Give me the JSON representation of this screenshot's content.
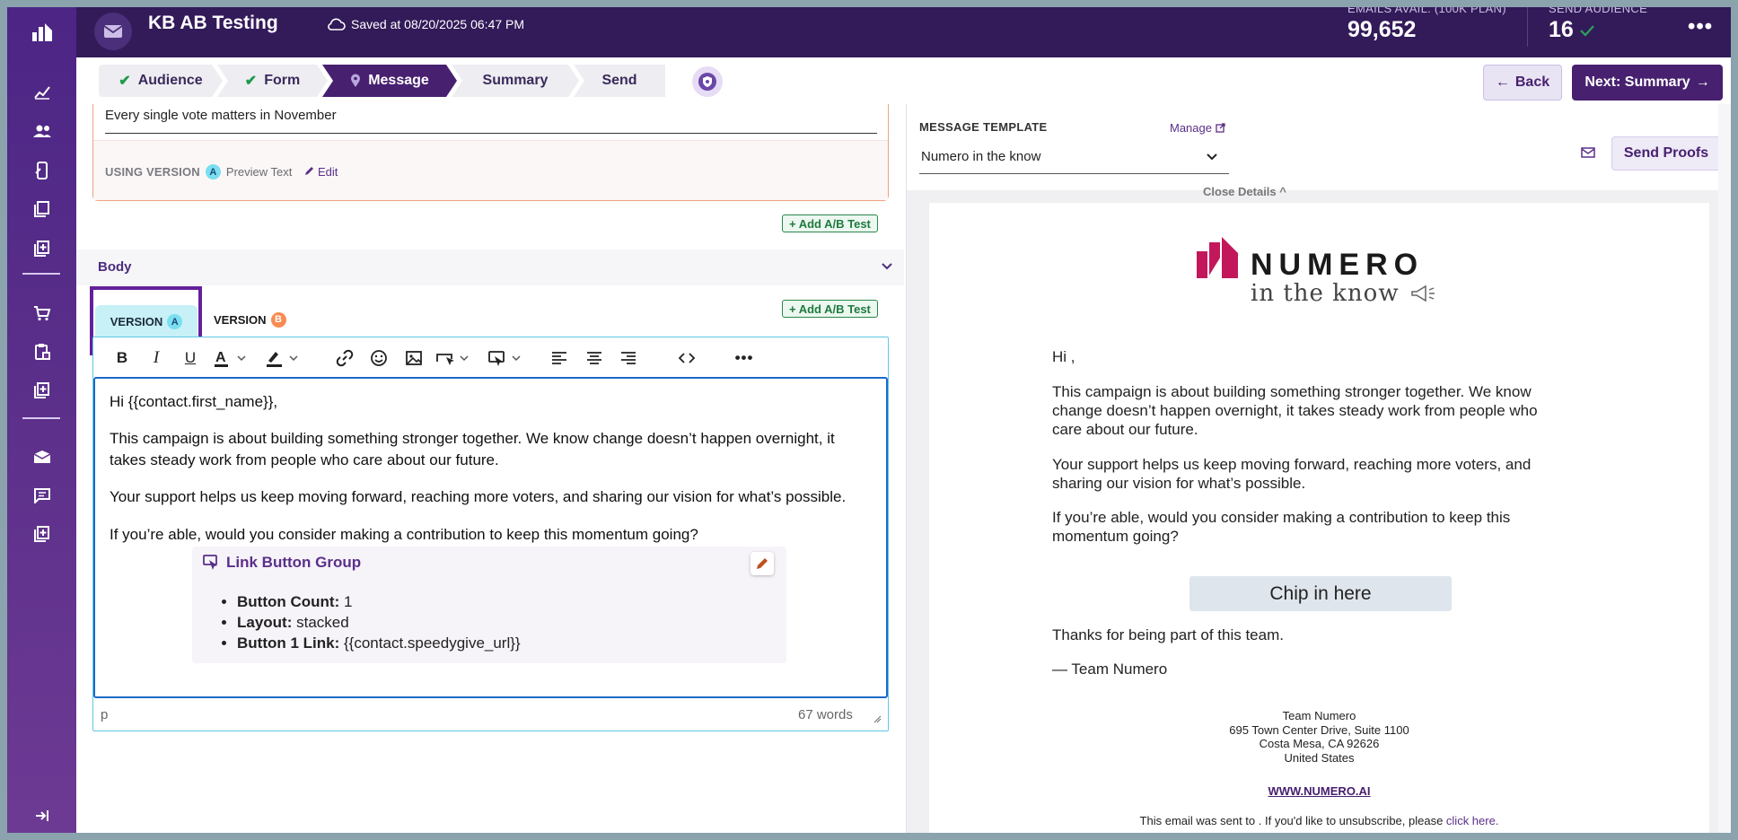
{
  "header": {
    "title": "KB AB Testing",
    "saved_text": "Saved at 08/20/2025 06:47 PM",
    "emails_label": "EMAILS AVAIL. (100K PLAN)",
    "emails_value": "99,652",
    "audience_label": "SEND AUDIENCE",
    "audience_value": "16"
  },
  "steps": [
    {
      "label": "Audience",
      "state": "done"
    },
    {
      "label": "Form",
      "state": "done"
    },
    {
      "label": "Message",
      "state": "active"
    },
    {
      "label": "Summary",
      "state": "todo"
    },
    {
      "label": "Send",
      "state": "todo"
    }
  ],
  "nav": {
    "back_label": "Back",
    "next_label": "Next: Summary"
  },
  "subject": {
    "preview_text": "Every single vote matters in November",
    "using_version_label": "USING VERSION",
    "version": "A",
    "field_name": "Preview Text",
    "edit_label": "Edit"
  },
  "add_ab_label": "+ Add A/B Test",
  "body_section": {
    "label": "Body",
    "version_a_label": "VERSION",
    "version_a_badge": "A",
    "version_b_label": "VERSION",
    "version_b_badge": "B"
  },
  "editor": {
    "greeting": "Hi {{contact.first_name}},",
    "paragraphs": [
      "This campaign is about building something stronger together. We know change doesn’t happen overnight, it takes steady work from people who care about our future.",
      "Your support helps us keep moving forward, reaching more voters, and sharing our vision for what’s possible.",
      "If you’re able, would you consider making a contribution to keep this momentum going?"
    ],
    "link_button_group": {
      "title": "Link Button Group",
      "items": [
        {
          "label": "Button Count:",
          "value": "1"
        },
        {
          "label": "Layout:",
          "value": "stacked"
        },
        {
          "label": "Button 1 Link:",
          "value": "{{contact.speedygive_url}}"
        }
      ]
    },
    "status_tag": "p",
    "word_count": "67 words"
  },
  "template": {
    "label": "MESSAGE TEMPLATE",
    "manage_label": "Manage",
    "selected": "Numero in the know",
    "send_proofs_label": "Send Proofs"
  },
  "preview": {
    "close_details": "Close Details ^",
    "logo_word": "NUMERO",
    "logo_tag": "in the know",
    "greeting": "Hi ,",
    "paragraphs": [
      "This campaign is about building something stronger together. We know change doesn’t happen overnight, it takes steady work from people who care about our future.",
      "Your support helps us keep moving forward, reaching more voters, and sharing our vision for what’s possible.",
      "If you’re able, would you consider making a contribution to keep this momentum going?"
    ],
    "button_label": "Chip in here",
    "thanks": "Thanks for being part of this team.",
    "signature": "— Team Numero",
    "address_lines": [
      "Team Numero",
      "695 Town Center Drive, Suite 1100",
      "Costa Mesa, CA 92626",
      "United States"
    ],
    "website": "WWW.NUMERO.AI",
    "unsubscribe_prefix": "This email was sent to . If you'd like to unsubscribe, please ",
    "unsubscribe_link": "click here."
  },
  "colors": {
    "brand": "#47206f",
    "header_bg": "#331a59",
    "done_check": "#1e9a49",
    "version_a": "#7adff0",
    "version_b": "#f98b52",
    "editor_focus": "#1b6ac9",
    "highlight_box": "#64209a"
  },
  "icons": {
    "rail": [
      "logo-icon",
      "analytics-icon",
      "contacts-icon",
      "mobile-icon",
      "pages-icon",
      "add-page-icon",
      "cart-icon",
      "clipboard-icon",
      "add-box-icon",
      "email-icon",
      "chat-icon",
      "add-template-icon",
      "collapse-icon"
    ]
  }
}
